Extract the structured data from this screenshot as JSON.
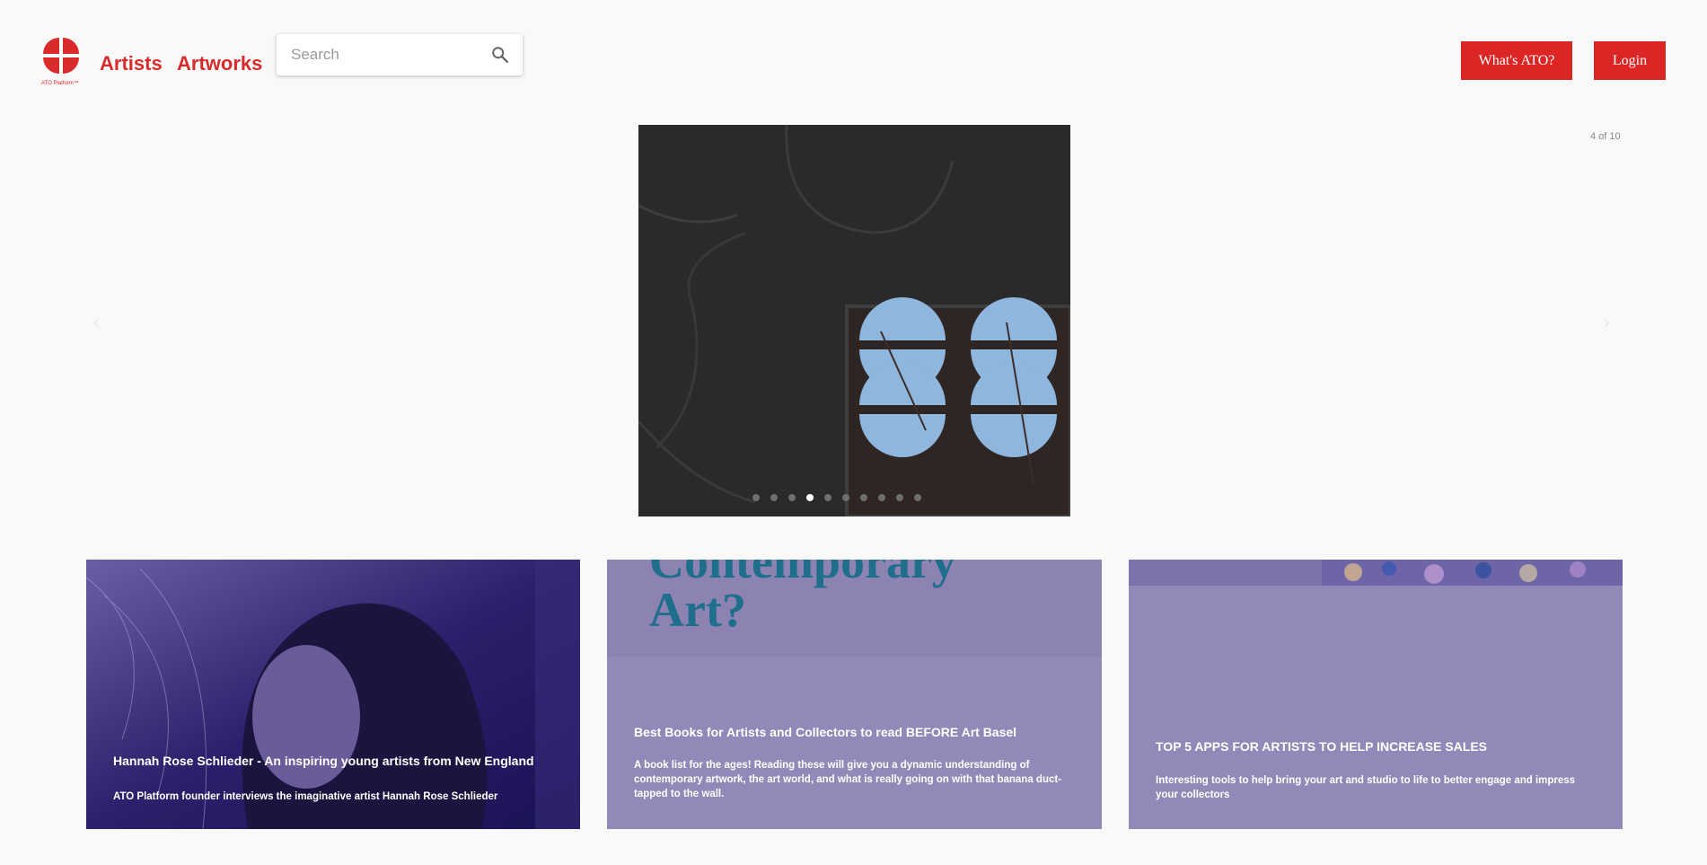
{
  "header": {
    "logo_caption": "ATO Platform™",
    "nav": [
      "Artists",
      "Artworks"
    ],
    "search_placeholder": "Search",
    "buttons": {
      "whats_ato": "What's ATO?",
      "login": "Login"
    }
  },
  "carousel": {
    "counter": "4 of 10",
    "prev_arrow": "‹",
    "next_arrow": "›",
    "current": 4,
    "total": 10
  },
  "cards": [
    {
      "title": "Hannah Rose Schlieder - An inspiring young artists from New England",
      "description": "ATO Platform founder interviews the imaginative artist Hannah Rose Schlieder"
    },
    {
      "image_text": [
        "Contemporary",
        "Art?"
      ],
      "title": "Best Books for Artists and Collectors to read BEFORE Art Basel",
      "description": "A book list for the ages! Reading these will give you a dynamic understanding of contemporary artwork, the art world, and what is really going on with that banana duct-tapped to the wall."
    },
    {
      "title": "TOP 5 APPS FOR ARTISTS TO HELP INCREASE SALES",
      "description": "Interesting tools to help bring your art and studio to life to better engage and impress your collectors"
    }
  ],
  "colors": {
    "brand_red": "#dc2626",
    "card_purple": "#9389b8",
    "headline_teal": "#1f6e8c"
  }
}
